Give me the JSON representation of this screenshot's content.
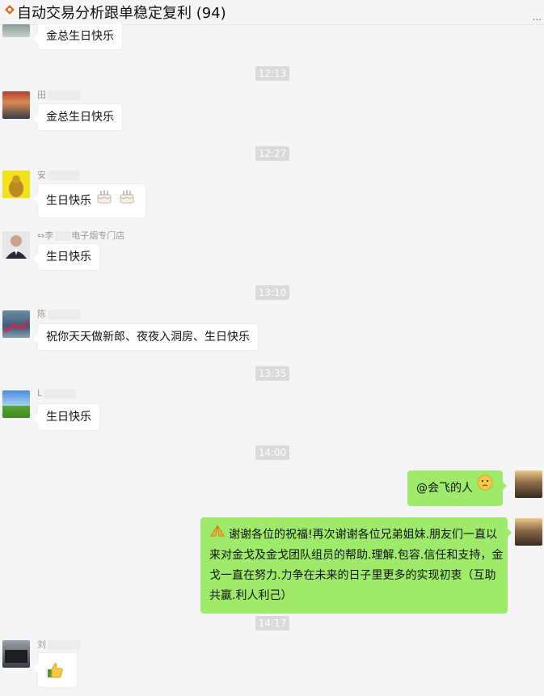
{
  "header": {
    "title": "自动交易分析跟单稳定复利 (94)",
    "more": "..."
  },
  "messages": {
    "m0": "金总生日快乐",
    "t1": "12:13",
    "n1": "田",
    "m1": "金总生日快乐",
    "t2": "12:27",
    "n2": "安",
    "m2": "生日快乐",
    "n3_a": "⇔李",
    "n3_b": "电子烟专门店",
    "m3": "生日快乐",
    "t3": "13:10",
    "n4": "陈",
    "m4": "祝你天天做新郎、夜夜入洞房、生日快乐",
    "t4": "13:35",
    "n5": "L",
    "m5": "生日快乐",
    "t5": "14:00",
    "m6": "@会飞的人",
    "m7_lines": [
      "谢谢各位的祝福!再次谢谢各位兄弟姐妹.朋友们一直以",
      "来对金戈及金戈团队组员的帮助.理解.包容.信任和支持，金",
      "戈一直在努力.力争在未来的日子里更多的实现初衷（互助",
      "共赢.利人利己）"
    ],
    "t6": "14:17",
    "n8": "刘"
  },
  "colors": {
    "self_bubble": "#9eea6a",
    "other_bubble": "#ffffff",
    "time_badge": "#dadada"
  }
}
